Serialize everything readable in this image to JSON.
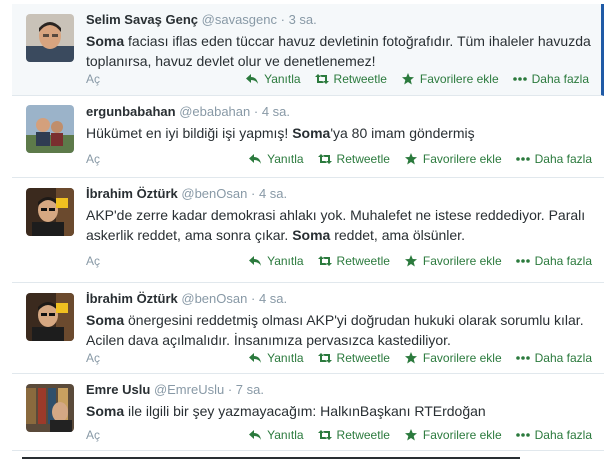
{
  "colors": {
    "action_green": "#2b7a3d",
    "meta_gray": "#8899a6",
    "text": "#292f33",
    "highlight_bar": "#1f5aa6"
  },
  "icons": [
    "reply-icon",
    "retweet-icon",
    "favorite-star-icon",
    "more-dots-icon"
  ],
  "tweets": [
    {
      "fullname": "Selim Savaş Genç",
      "username": "@savasgenc",
      "dot": "·",
      "time": "3 sa.",
      "segments": [
        {
          "bold": "Soma"
        },
        {
          "text": " faciası iflas eden tüccar havuz devletinin fotoğrafıdır. Tüm ihaleler havuzda toplanırsa, havuz devlet olur ve denetlenemez!"
        }
      ],
      "expand": "Aç",
      "actions": {
        "reply": "Yanıtla",
        "retweet": "Retweetle",
        "favorite": "Favorilere ekle",
        "more": "Daha fazla"
      }
    },
    {
      "fullname": "ergunbabahan",
      "username": "@ebabahan",
      "dot": "·",
      "time": "4 sa.",
      "segments": [
        {
          "text": "Hükümet en iyi bildiği işi yapmış! "
        },
        {
          "bold": "Soma"
        },
        {
          "text": "'ya 80 imam göndermiş"
        }
      ],
      "expand": "Aç",
      "actions": {
        "reply": "Yanıtla",
        "retweet": "Retweetle",
        "favorite": "Favorilere ekle",
        "more": "Daha fazla"
      }
    },
    {
      "fullname": "İbrahim Öztürk",
      "username": "@benOsan",
      "dot": "·",
      "time": "4 sa.",
      "segments": [
        {
          "text": "AKP'de zerre kadar demokrasi ahlakı yok. Muhalefet ne istese reddediyor. Paralı askerlik reddet, ama sonra çıkar. "
        },
        {
          "bold": "Soma"
        },
        {
          "text": " reddet, ama ölsünler."
        }
      ],
      "expand": "Aç",
      "actions": {
        "reply": "Yanıtla",
        "retweet": "Retweetle",
        "favorite": "Favorilere ekle",
        "more": "Daha fazla"
      }
    },
    {
      "fullname": "İbrahim Öztürk",
      "username": "@benOsan",
      "dot": "·",
      "time": "4 sa.",
      "segments": [
        {
          "bold": "Soma"
        },
        {
          "text": " önergesini reddetmiş olması AKP'yi doğrudan hukuki olarak sorumlu kılar. Acilen dava açılmalıdır. İnsanımıza pervasızca kastediliyor."
        }
      ],
      "expand": "Aç",
      "actions": {
        "reply": "Yanıtla",
        "retweet": "Retweetle",
        "favorite": "Favorilere ekle",
        "more": "Daha fazla"
      }
    },
    {
      "fullname": "Emre Uslu",
      "username": "@EmreUslu",
      "dot": "·",
      "time": "7 sa.",
      "segments": [
        {
          "bold": "Soma"
        },
        {
          "text": " ile ilgili bir şey yazmayacağım: HalkınBaşkanı RTErdoğan"
        }
      ],
      "expand": "Aç",
      "actions": {
        "reply": "Yanıtla",
        "retweet": "Retweetle",
        "favorite": "Favorilere ekle",
        "more": "Daha fazla"
      }
    }
  ]
}
